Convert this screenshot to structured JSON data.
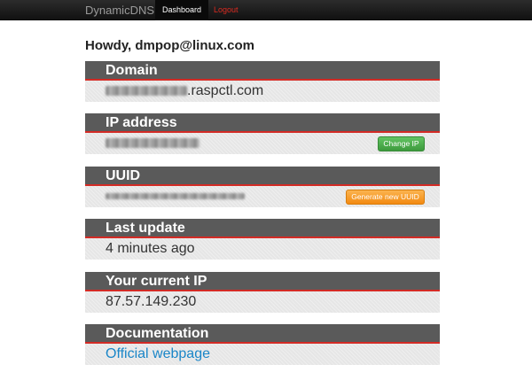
{
  "navbar": {
    "brand": "DynamicDNS",
    "items": [
      {
        "label": "Dashboard",
        "active": true
      },
      {
        "label": "Logout",
        "active": false
      }
    ]
  },
  "greeting": "Howdy, dmpop@linux.com",
  "sections": {
    "domain": {
      "title": "Domain",
      "value_suffix": ".raspctl.com"
    },
    "ip_address": {
      "title": "IP address",
      "button": "Change IP"
    },
    "uuid": {
      "title": "UUID",
      "button": "Generate new UUID"
    },
    "last_update": {
      "title": "Last update",
      "value": "4 minutes ago"
    },
    "current_ip": {
      "title": "Your current IP",
      "value": "87.57.149.230"
    },
    "documentation": {
      "title": "Documentation",
      "link": "Official webpage"
    }
  },
  "colors": {
    "header_bg": "#5a5a5a",
    "header_border": "#d32b25",
    "link": "#1a86c8",
    "button_green": "#51a351",
    "button_orange": "#f89406"
  }
}
